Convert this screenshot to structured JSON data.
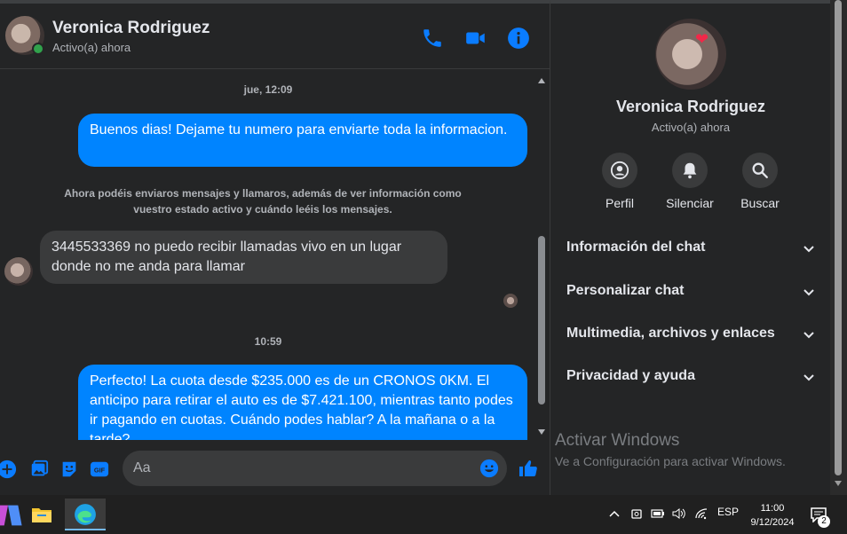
{
  "header": {
    "name": "Veronica Rodriguez",
    "status": "Activo(a) ahora"
  },
  "messages": {
    "ts1": "jue, 12:09",
    "out1": "Buenos dias! Dejame tu numero para enviarte toda la informacion.",
    "system": "Ahora podéis enviaros mensajes y llamaros, además de ver información como vuestro estado activo y cuándo leéis los mensajes.",
    "in1": "3445533369 no puedo recibir llamadas vivo en un lugar donde  no me anda para llamar",
    "ts2": "10:59",
    "out2": "Perfecto! La cuota desde $235.000 es de un CRONOS 0KM. El anticipo para retirar el auto es de $7.421.100, mientras tanto podes ir pagando en cuotas. Cuándo podes hablar? A la mañana o a la tarde?"
  },
  "composer": {
    "placeholder": "Aa"
  },
  "side": {
    "name": "Veronica Rodriguez",
    "status": "Activo(a) ahora",
    "actions": [
      {
        "label": "Perfil",
        "icon": "profile-icon"
      },
      {
        "label": "Silenciar",
        "icon": "bell-icon"
      },
      {
        "label": "Buscar",
        "icon": "search-icon"
      }
    ],
    "sections": [
      "Información del chat",
      "Personalizar chat",
      "Multimedia, archivos y enlaces",
      "Privacidad y ayuda"
    ],
    "activate_title": "Activar Windows",
    "activate_sub": "Ve a Configuración para activar Windows."
  },
  "taskbar": {
    "lang": "ESP",
    "time": "11:00",
    "date": "9/12/2024",
    "notifications": "2"
  },
  "colors": {
    "accent": "#0084ff",
    "background": "#242526",
    "bubble_in": "#3a3b3c"
  }
}
